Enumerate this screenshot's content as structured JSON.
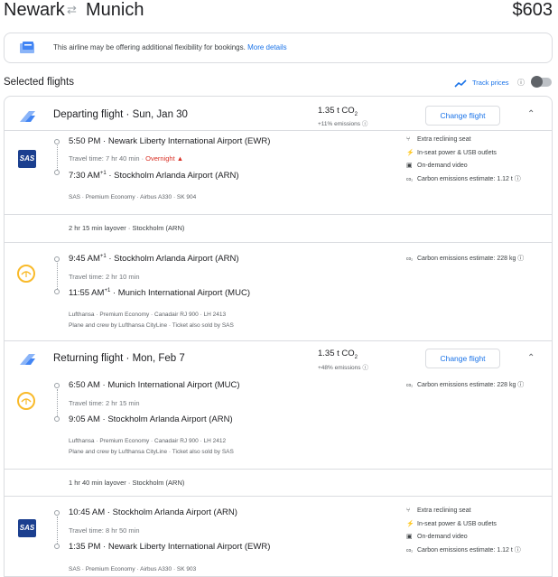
{
  "header": {
    "origin": "Newark",
    "destination": "Munich",
    "swap_icon": "swap-arrows-icon",
    "price": "$603"
  },
  "banner": {
    "text": "This airline may be offering additional flexibility for bookings.",
    "link": "More details"
  },
  "selected": {
    "title": "Selected flights",
    "track_label": "Track prices"
  },
  "depart": {
    "title": "Departing flight · Sun, Jan 30",
    "co2": "1.35 t CO",
    "co2_sub": "2",
    "emissions": "+11% emissions",
    "change": "Change flight",
    "leg1": {
      "dep_time": "5:50 PM",
      "dep_airport": "Newark Liberty International Airport (EWR)",
      "travel": "Travel time: 7 hr 40 min",
      "overnight": "Overnight",
      "arr_time": "7:30 AM",
      "arr_sup": "+1",
      "arr_airport": "Stockholm Arlanda Airport (ARN)",
      "info": "SAS · Premium Economy · Airbus A330 · SK 904",
      "amenities": [
        "Extra reclining seat",
        "In-seat power & USB outlets",
        "On-demand video",
        "Carbon emissions estimate: 1.12 t"
      ]
    },
    "layover": "2 hr 15 min layover · Stockholm (ARN)",
    "leg2": {
      "dep_time": "9:45 AM",
      "dep_sup": "+1",
      "dep_airport": "Stockholm Arlanda Airport (ARN)",
      "travel": "Travel time: 2 hr 10 min",
      "arr_time": "11:55 AM",
      "arr_sup": "+1",
      "arr_airport": "Munich International Airport (MUC)",
      "info": "Lufthansa · Premium Economy · Canadair RJ 900 · LH 2413",
      "info2": "Plane and crew by Lufthansa CityLine · Ticket also sold by SAS",
      "carbon": "Carbon emissions estimate: 228 kg"
    }
  },
  "return": {
    "title": "Returning flight · Mon, Feb 7",
    "co2": "1.35 t CO",
    "co2_sub": "2",
    "emissions": "+48% emissions",
    "change": "Change flight",
    "leg1": {
      "dep_time": "6:50 AM",
      "dep_airport": "Munich International Airport (MUC)",
      "travel": "Travel time: 2 hr 15 min",
      "arr_time": "9:05 AM",
      "arr_airport": "Stockholm Arlanda Airport (ARN)",
      "info": "Lufthansa · Premium Economy · Canadair RJ 900 · LH 2412",
      "info2": "Plane and crew by Lufthansa CityLine · Ticket also sold by SAS",
      "carbon": "Carbon emissions estimate: 228 kg"
    },
    "layover": "1 hr 40 min layover · Stockholm (ARN)",
    "leg2": {
      "dep_time": "10:45 AM",
      "dep_airport": "Stockholm Arlanda Airport (ARN)",
      "travel": "Travel time: 8 hr 50 min",
      "arr_time": "1:35 PM",
      "arr_airport": "Newark Liberty International Airport (EWR)",
      "info": "SAS · Premium Economy · Airbus A330 · SK 903",
      "amenities": [
        "Extra reclining seat",
        "In-seat power & USB outlets",
        "On-demand video",
        "Carbon emissions estimate: 1.12 t"
      ]
    }
  },
  "logos": {
    "sas": "SAS"
  },
  "colors": {
    "accent": "#1a73e8",
    "warning": "#d93025",
    "lufthansa": "#f9ba2a",
    "sas": "#1b3f8f"
  }
}
